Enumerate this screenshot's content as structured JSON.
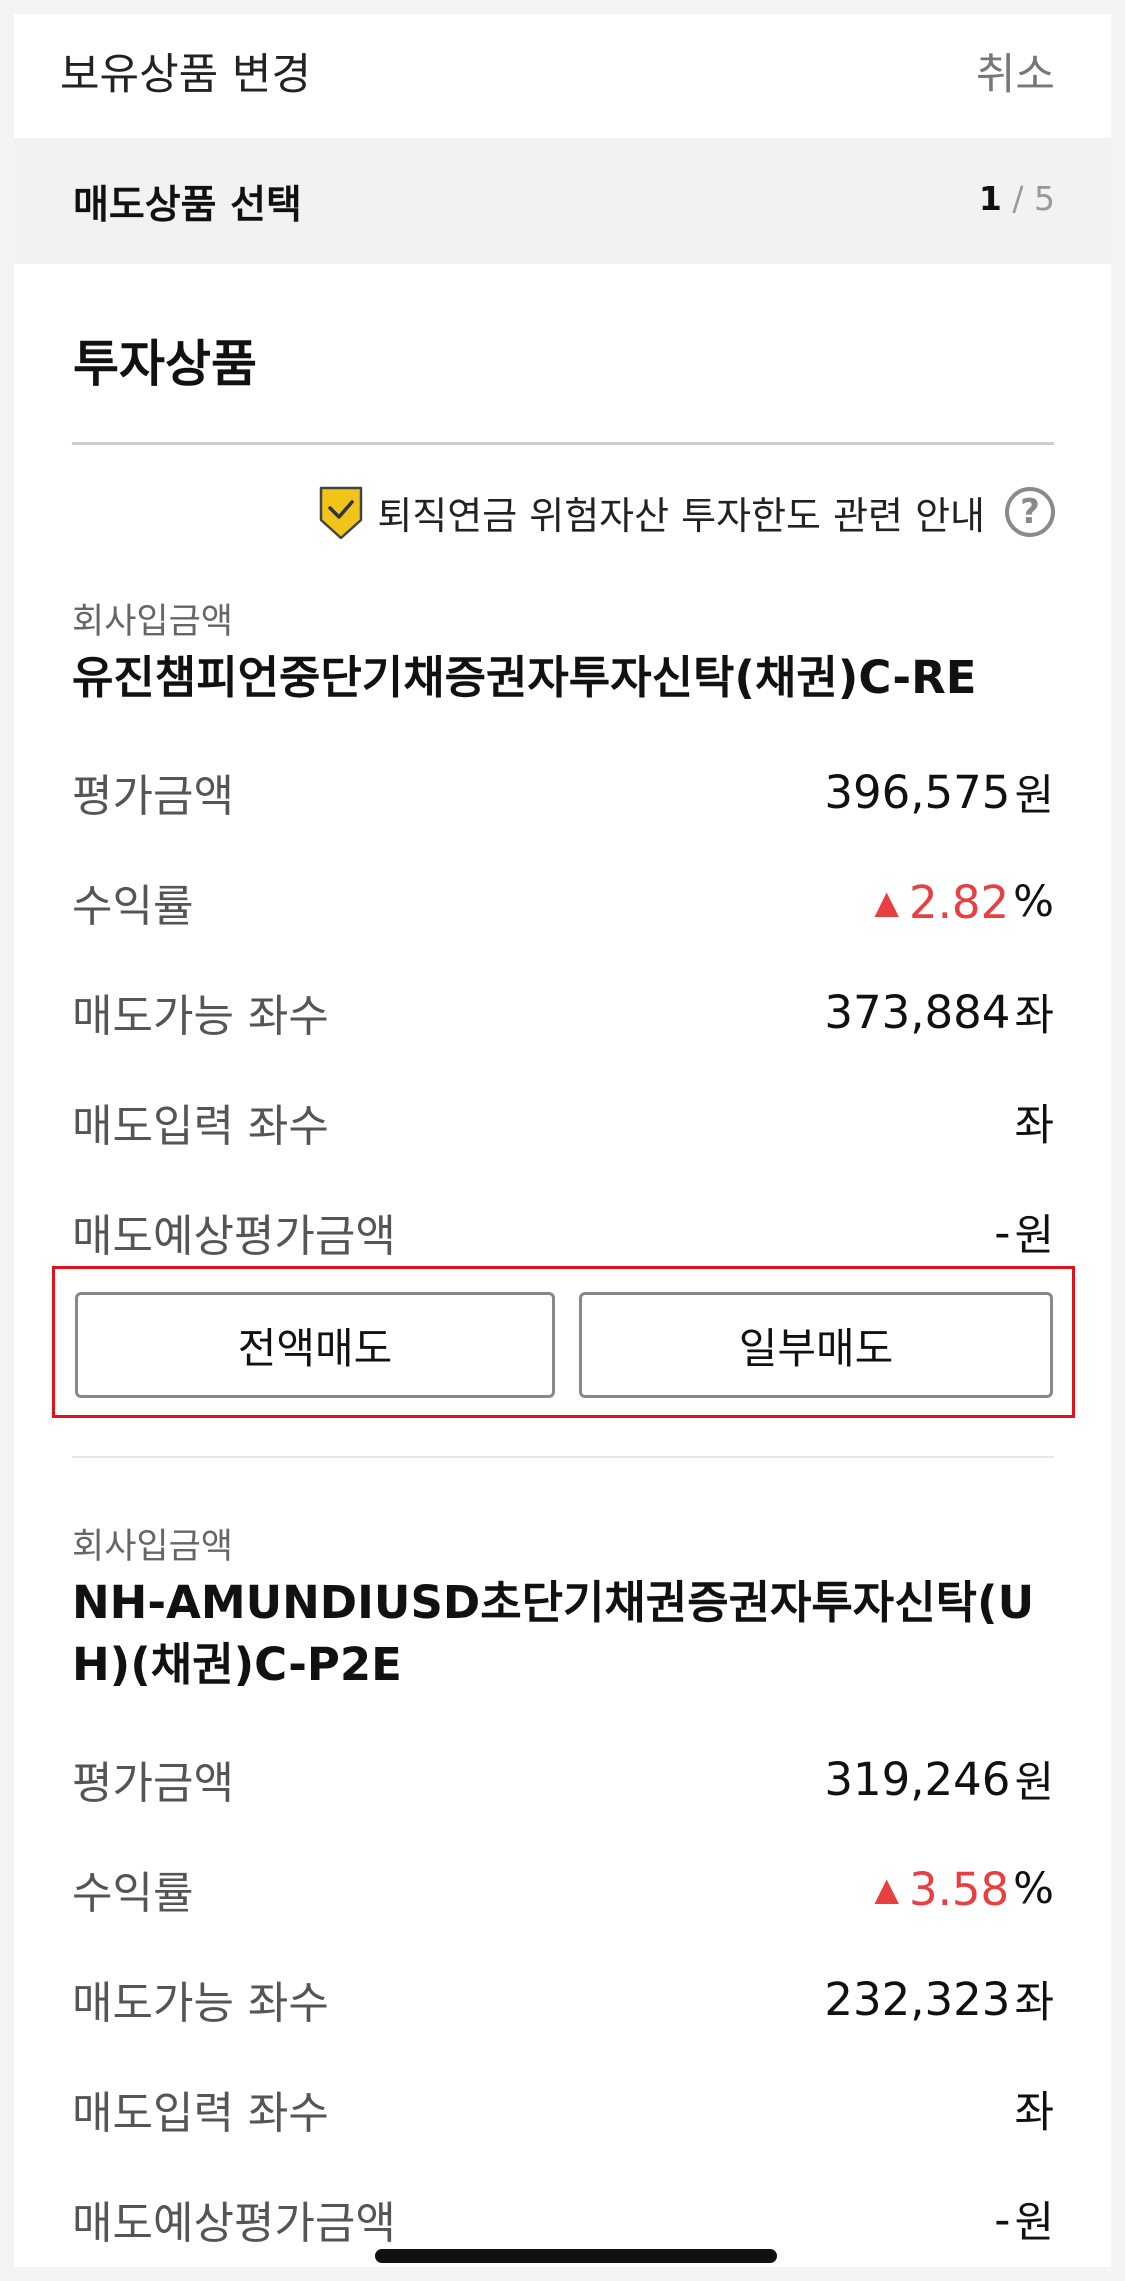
{
  "header": {
    "title": "보유상품 변경",
    "cancel": "취소"
  },
  "step": {
    "label": "매도상품 선택",
    "current": "1",
    "total": "/ 5"
  },
  "section_title": "투자상품",
  "notice": {
    "text": "퇴직연금 위험자산 투자한도 관련 안내",
    "icon": "shield-check-icon",
    "help_icon": "question-icon"
  },
  "products": [
    {
      "category": "회사입금액",
      "name": "유진챔피언중단기채증권자투자신탁(채권)C-RE",
      "eval_label": "평가금액",
      "eval_value": "396,575",
      "eval_unit": "원",
      "return_label": "수익률",
      "return_value": "2.82",
      "return_unit": "%",
      "sellable_label": "매도가능 좌수",
      "sellable_value": "373,884",
      "sellable_unit": "좌",
      "input_label": "매도입력 좌수",
      "input_value": "",
      "input_unit": "좌",
      "expected_label": "매도예상평가금액",
      "expected_value": "-",
      "expected_unit": "원",
      "btn_full": "전액매도",
      "btn_partial": "일부매도"
    },
    {
      "category": "회사입금액",
      "name": "NH-AMUNDIUSD초단기채권증권자투자신탁(U H)(채권)C-P2E",
      "eval_label": "평가금액",
      "eval_value": "319,246",
      "eval_unit": "원",
      "return_label": "수익률",
      "return_value": "3.58",
      "return_unit": "%",
      "sellable_label": "매도가능 좌수",
      "sellable_value": "232,323",
      "sellable_unit": "좌",
      "input_label": "매도입력 좌수",
      "input_value": "",
      "input_unit": "좌",
      "expected_label": "매도예상평가금액",
      "expected_value": "-",
      "expected_unit": "원"
    }
  ],
  "colors": {
    "up": "#e84040",
    "highlight": "#e3121a",
    "shield": "#f0c419"
  }
}
